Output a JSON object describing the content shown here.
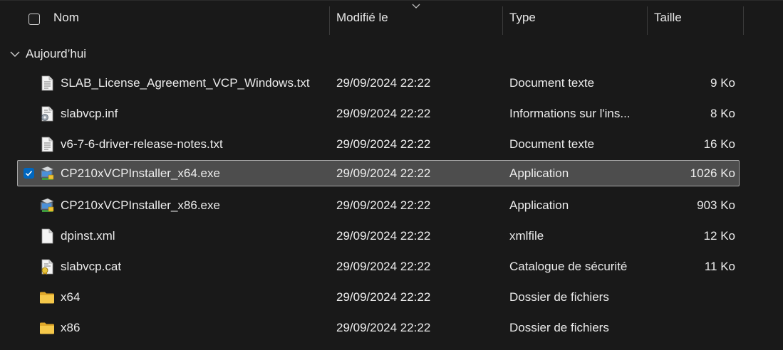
{
  "header": {
    "name": "Nom",
    "modified": "Modifié le",
    "type": "Type",
    "size": "Taille"
  },
  "group": {
    "label": "Aujourd’hui"
  },
  "files": [
    {
      "name": "SLAB_License_Agreement_VCP_Windows.txt",
      "modified": "29/09/2024 22:22",
      "type": "Document texte",
      "size": "9 Ko",
      "icon": "text-file-icon",
      "selected": false
    },
    {
      "name": "slabvcp.inf",
      "modified": "29/09/2024 22:22",
      "type": "Informations sur l'ins...",
      "size": "8 Ko",
      "icon": "setup-info-file-icon",
      "selected": false
    },
    {
      "name": "v6-7-6-driver-release-notes.txt",
      "modified": "29/09/2024 22:22",
      "type": "Document texte",
      "size": "16 Ko",
      "icon": "text-file-icon",
      "selected": false
    },
    {
      "name": "CP210xVCPInstaller_x64.exe",
      "modified": "29/09/2024 22:22",
      "type": "Application",
      "size": "1026 Ko",
      "icon": "installer-app-icon",
      "selected": true
    },
    {
      "name": "CP210xVCPInstaller_x86.exe",
      "modified": "29/09/2024 22:22",
      "type": "Application",
      "size": "903 Ko",
      "icon": "installer-app-icon",
      "selected": false
    },
    {
      "name": "dpinst.xml",
      "modified": "29/09/2024 22:22",
      "type": "xmlfile",
      "size": "12 Ko",
      "icon": "blank-file-icon",
      "selected": false
    },
    {
      "name": "slabvcp.cat",
      "modified": "29/09/2024 22:22",
      "type": "Catalogue de sécurité",
      "size": "11 Ko",
      "icon": "security-catalog-icon",
      "selected": false
    },
    {
      "name": "x64",
      "modified": "29/09/2024 22:22",
      "type": "Dossier de fichiers",
      "size": "",
      "icon": "folder-icon",
      "selected": false
    },
    {
      "name": "x86",
      "modified": "29/09/2024 22:22",
      "type": "Dossier de fichiers",
      "size": "",
      "icon": "folder-icon",
      "selected": false
    }
  ],
  "colors": {
    "background": "#191919",
    "selection": "#4d4d4d",
    "selection_border": "#a8a8a8",
    "checkbox_accent": "#0067c0",
    "folder": "#f3c33a"
  }
}
